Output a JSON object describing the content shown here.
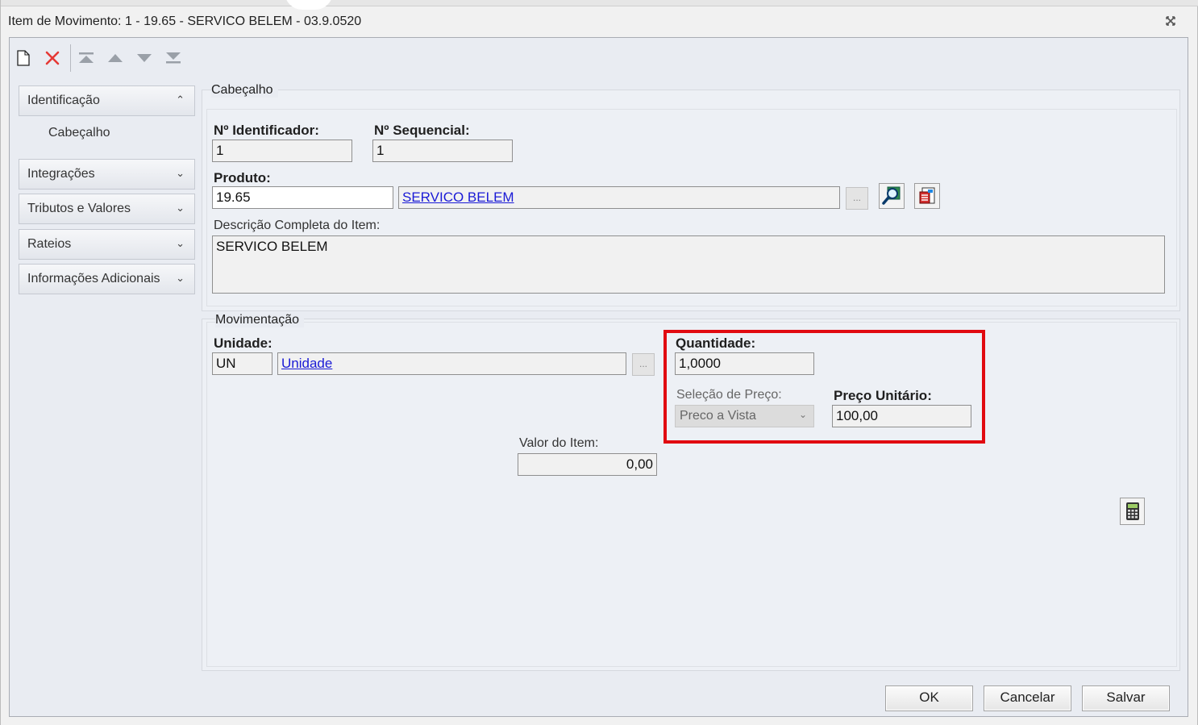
{
  "window": {
    "title": "Item de Movimento: 1 - 19.65 - SERVICO BELEM - 03.9.0520",
    "close_icon": "close-icon"
  },
  "toolbar": {
    "icons": [
      "new-document-icon",
      "delete-icon",
      "first-record-icon",
      "previous-record-icon",
      "next-record-icon",
      "last-record-icon"
    ]
  },
  "nav": {
    "groups": [
      {
        "label": "Identificação",
        "expanded": true,
        "children": [
          "Cabeçalho"
        ]
      },
      {
        "label": "Integrações",
        "expanded": false
      },
      {
        "label": "Tributos e Valores",
        "expanded": false
      },
      {
        "label": "Rateios",
        "expanded": false
      },
      {
        "label": "Informações Adicionais",
        "expanded": false
      }
    ]
  },
  "cabecalho": {
    "legend": "Cabeçalho",
    "identificador_label": "Nº Identificador:",
    "identificador_value": "1",
    "sequencial_label": "Nº Sequencial:",
    "sequencial_value": "1",
    "produto_label": "Produto:",
    "produto_code": "19.65",
    "produto_name": "SERVICO BELEM",
    "produto_dots": "...",
    "descricao_label": "Descrição Completa do Item:",
    "descricao_value": "SERVICO BELEM"
  },
  "movimentacao": {
    "legend": "Movimentação",
    "unidade_label": "Unidade:",
    "unidade_code": "UN",
    "unidade_name": "Unidade",
    "unidade_dots": "...",
    "quantidade_label": "Quantidade:",
    "quantidade_value": "1,0000",
    "selecao_label": "Seleção de Preço:",
    "selecao_value": "Preco a Vista",
    "preco_label": "Preço Unitário:",
    "preco_value": "100,00",
    "valor_label": "Valor do Item:",
    "valor_value": "0,00"
  },
  "buttons": {
    "ok": "OK",
    "cancel": "Cancelar",
    "save": "Salvar"
  },
  "colors": {
    "highlight": "#e10a10",
    "link": "#1a1ad6",
    "delete": "#e53935"
  }
}
